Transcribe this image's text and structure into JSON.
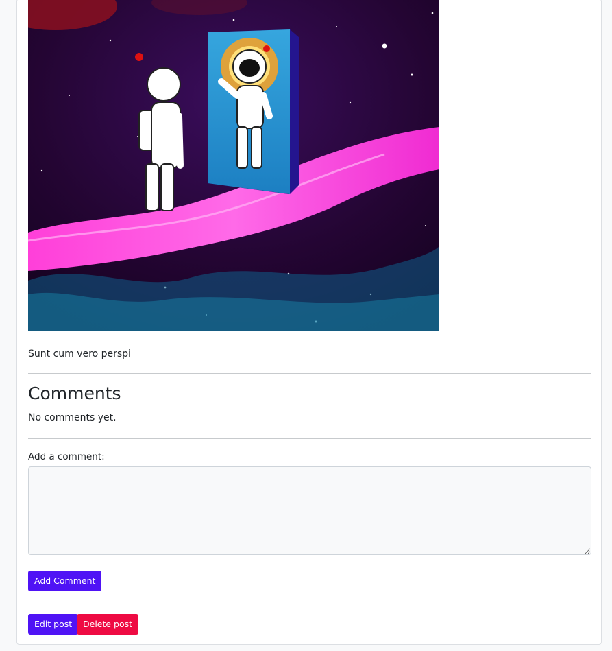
{
  "post": {
    "image_alt": "Illustration of an astronaut facing a doorway with another astronaut, on a pink path through space",
    "body": "Sunt cum vero perspi"
  },
  "comments": {
    "heading": "Comments",
    "empty_text": "No comments yet."
  },
  "comment_form": {
    "label": "Add a comment:",
    "value": "",
    "submit_label": "Add Comment"
  },
  "actions": {
    "edit_label": "Edit post",
    "delete_label": "Delete post"
  },
  "colors": {
    "primary": "#4f13f5",
    "danger": "#ee0b43",
    "page_bg": "#f8f9fa"
  }
}
